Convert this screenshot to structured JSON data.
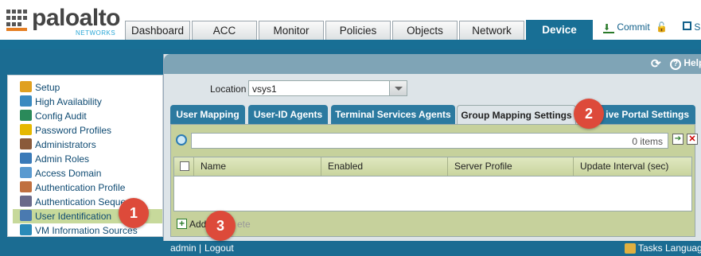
{
  "brand": {
    "name": "paloalto",
    "sub": "NETWORKS"
  },
  "top_tabs": [
    "Dashboard",
    "ACC",
    "Monitor",
    "Policies",
    "Objects",
    "Network",
    "Device"
  ],
  "active_top_tab": "Device",
  "top_actions": {
    "commit": "Commit",
    "save": "S"
  },
  "header": {
    "help": "Help"
  },
  "sidebar": {
    "items": [
      {
        "label": "Setup",
        "color": "#e0a020"
      },
      {
        "label": "High Availability",
        "color": "#3a8ac0"
      },
      {
        "label": "Config Audit",
        "color": "#2a8a5a"
      },
      {
        "label": "Password Profiles",
        "color": "#e6b800"
      },
      {
        "label": "Administrators",
        "color": "#8a5a3a"
      },
      {
        "label": "Admin Roles",
        "color": "#3a7ab8"
      },
      {
        "label": "Access Domain",
        "color": "#5a9ad0"
      },
      {
        "label": "Authentication Profile",
        "color": "#c07040"
      },
      {
        "label": "Authentication Sequence",
        "color": "#6a6a8a"
      },
      {
        "label": "User Identification",
        "color": "#4a7ab0",
        "selected": true
      },
      {
        "label": "VM Information Sources",
        "color": "#2a8ab8"
      }
    ]
  },
  "location": {
    "label": "Location",
    "value": "vsys1"
  },
  "sub_tabs": [
    "User Mapping",
    "User-ID Agents",
    "Terminal Services Agents",
    "Group Mapping Settings",
    "ive Portal Settings"
  ],
  "active_sub_tab": "Group Mapping Settings",
  "search": {
    "count": "0 items"
  },
  "table": {
    "columns": [
      "Name",
      "Enabled",
      "Server Profile",
      "Update Interval (sec)"
    ]
  },
  "actions": {
    "add": "Add",
    "delete": "ete"
  },
  "status": {
    "user": "admin",
    "logout": "Logout",
    "tasks": "Tasks",
    "language": "Language"
  },
  "badges": [
    "1",
    "2",
    "3"
  ],
  "colors": {
    "brand_blue": "#186f95",
    "badge_red": "#dd4a3a",
    "selected_green": "#c7d99b"
  }
}
